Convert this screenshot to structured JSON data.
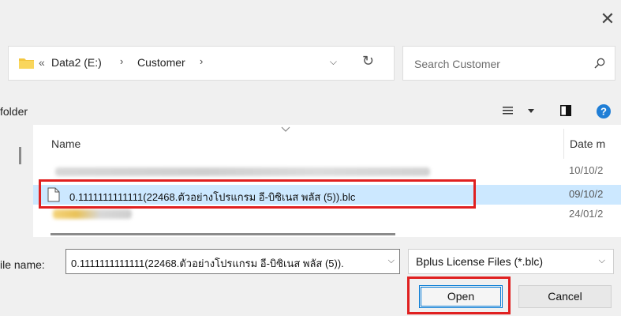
{
  "window": {
    "close_glyph": "✕"
  },
  "address": {
    "overflow": "«",
    "crumbs": [
      "Data2 (E:)",
      "Customer"
    ],
    "separator": "›",
    "dropdown_glyph": "⌵",
    "refresh_glyph": "↻"
  },
  "search": {
    "placeholder": "Search Customer"
  },
  "toolbar": {
    "new_folder_label": "folder"
  },
  "columns": {
    "name": "Name",
    "date": "Date m"
  },
  "rows": [
    {
      "name": "",
      "date": "10/10/2",
      "selected": false,
      "blurred": true
    },
    {
      "name": "0.1111111111111(22468.ตัวอย่างโปรแกรม อี-บิซิเนส พลัส (5)).blc",
      "date": "09/10/2",
      "selected": true,
      "blurred": false
    },
    {
      "name": "",
      "date": "24/01/2",
      "selected": false,
      "blurred": true,
      "type": "folder"
    }
  ],
  "bottom": {
    "filename_label": "ile name:",
    "filename_value": "0.1111111111111(22468.ตัวอย่างโปรแกรม อี-บิซิเนส พลัส (5)).",
    "filetype_value": "Bplus License Files (*.blc)",
    "open_label": "Open",
    "cancel_label": "Cancel"
  },
  "colors": {
    "selection": "#cce8ff",
    "highlight": "#e02020",
    "accent": "#0078d4"
  }
}
